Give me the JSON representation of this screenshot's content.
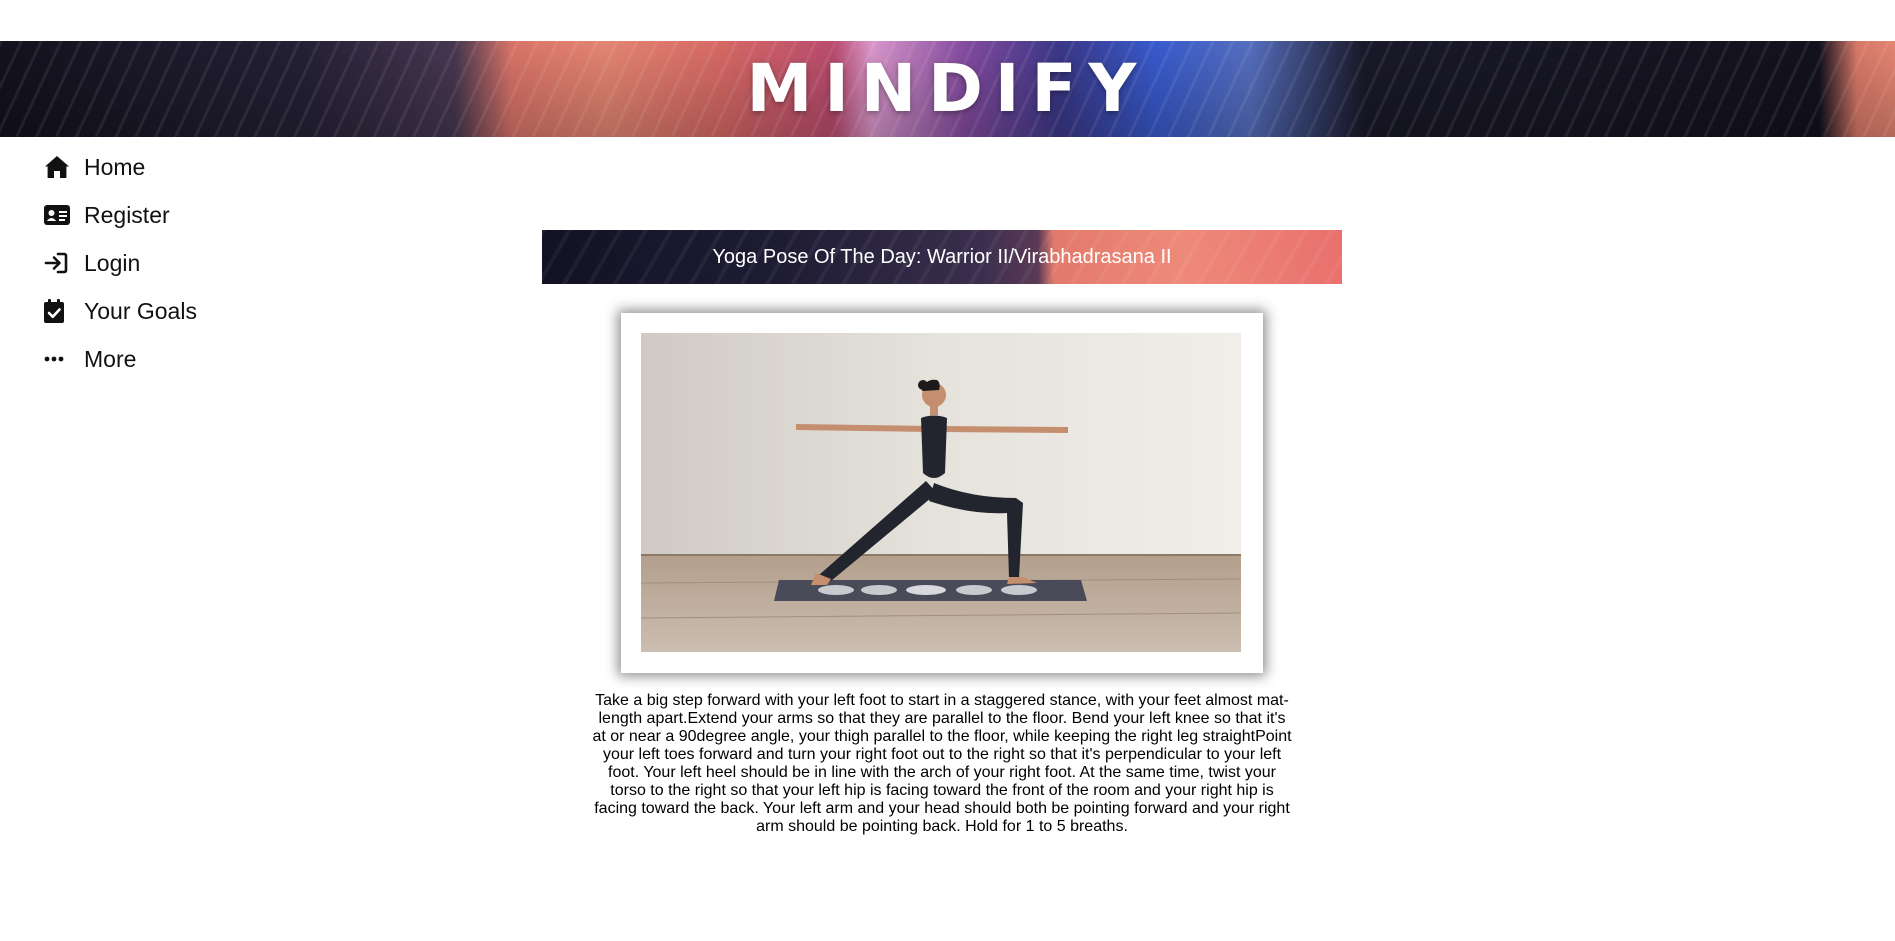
{
  "header": {
    "brand": "MINDIFY"
  },
  "nav": {
    "items": [
      {
        "label": "Home",
        "icon": "home-icon"
      },
      {
        "label": "Register",
        "icon": "id-card-icon"
      },
      {
        "label": "Login",
        "icon": "sign-in-icon"
      },
      {
        "label": "Your Goals",
        "icon": "calendar-check-icon"
      },
      {
        "label": "More",
        "icon": "ellipsis-icon"
      }
    ]
  },
  "pose": {
    "title": "Yoga Pose Of The Day: Warrior II/Virabhadrasana II",
    "image_alt": "Woman in Warrior II yoga pose on a mat",
    "description": "Take a big step forward with your left foot to start in a staggered stance, with your feet almost mat-length apart.Extend your arms so that they are parallel to the floor. Bend your left knee so that it's at or near a 90degree angle, your thigh parallel to the floor, while keeping the right leg straightPoint your left toes forward and turn your right foot out to the right so that it's perpendicular to your left foot. Your left heel should be in line with the arch of your right foot. At the same time, twist your torso to the right so that your left hip is facing toward the front of the room and your right hip is facing toward the back. Your left arm and your head should both be pointing forward and your right arm should be pointing back. Hold for 1 to 5 breaths."
  },
  "colors": {
    "nav_text": "#111111",
    "banner_text": "#ffffff",
    "accent_coral": "#ee8a7a",
    "accent_navy": "#121224"
  }
}
